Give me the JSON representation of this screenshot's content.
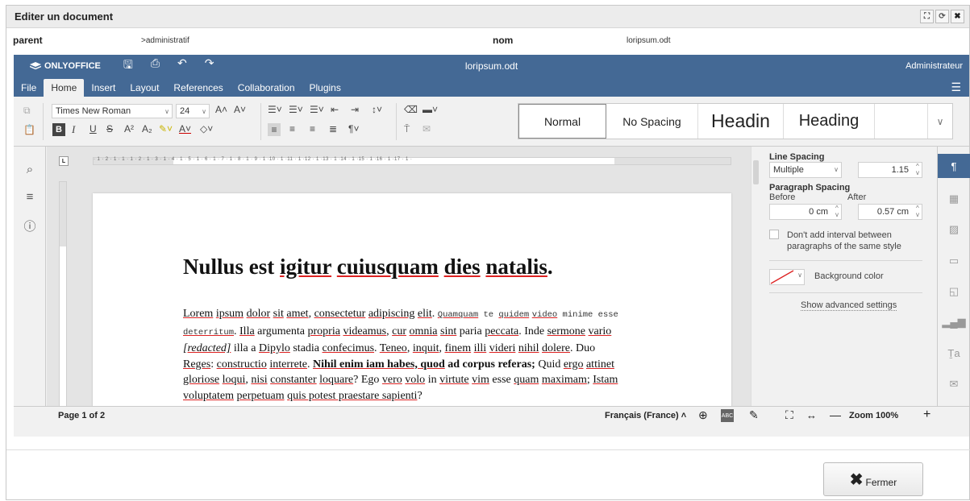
{
  "dialog": {
    "title": "Editer un document"
  },
  "meta": {
    "parent_label": "parent",
    "parent_value": ">administratif",
    "name_label": "nom",
    "name_value": "loripsum.odt"
  },
  "editor": {
    "brand": "ONLYOFFICE",
    "doc_title": "loripsum.odt",
    "user": "Administrateur",
    "tabs": [
      "File",
      "Home",
      "Insert",
      "Layout",
      "References",
      "Collaboration",
      "Plugins"
    ],
    "active_tab": "Home",
    "font": {
      "family": "Times New Roman",
      "size": "24"
    },
    "styles": [
      "Normal",
      "No Spacing",
      "Headin",
      "Heading"
    ],
    "ruler_h": "· 1 · 2 · 1 · 1 · 1 · 2 · 1 · 3 · 1 · 4 · 1 · 5 · 1 · 6 · 1 · 7 · 1 · 8 · 1 · 9 · 1 ·10 · 1 ·11 · 1 ·12 · 1 ·13 · 1 ·14 · 1 ·15 · 1 ·16 · 1 ·17 · 1 ·"
  },
  "document": {
    "heading": {
      "w1": "Nullus est",
      "w2": "igitur",
      "w3": "cuiusquam",
      "w4": "dies",
      "w5": "natalis",
      "end": "."
    },
    "p": {
      "a1": "Lorem",
      "a2": "ipsum",
      "a3": "dolor",
      "a4": "sit",
      "a5": "amet",
      "a6": ", ",
      "a7": "consectetur",
      "a8": "adipiscing",
      "a9": "elit",
      "m1": "Quamquam",
      "m2": " te ",
      "m3": "quidem",
      "m4": "video",
      "m5": " minime esse",
      "m6": "deterritum",
      "b1": ". ",
      "b2": "Illa",
      "b3": " argumenta ",
      "b4": "propria",
      "b5": "videamus",
      "b6": ", ",
      "b7": "cur",
      "b8": "omnia",
      "b9": "sint",
      "b10": " paria ",
      "b11": "peccata",
      "b12": ". Inde ",
      "b13": "sermone",
      "b14": "vario",
      "c1": "[redacted]",
      "c2": " illa a ",
      "c3": "Dipylo",
      "c4": " stadia ",
      "c5": "confecimus",
      "c6": ". ",
      "c7": "Teneo",
      "c8": ", ",
      "c9": "inquit",
      "c10": ", ",
      "c11": "finem",
      "c12": "illi",
      "c13": "videri",
      "c14": "nihil",
      "c15": "dolere",
      "c16": ". Duo",
      "d1": "Reges",
      "d2": ": ",
      "d3": "constructio",
      "d4": "interrete",
      "d5": ". ",
      "d6": "Nihil enim iam habes, quod",
      "d7": " ad corpus referas;",
      "d8": " Quid ",
      "d9": "ergo",
      "d10": "attinet",
      "e1": "gloriose",
      "e2": "loqui",
      "e3": ", ",
      "e4": "nisi",
      "e5": "constanter",
      "e6": "loquare",
      "e7": "? Ego ",
      "e8": "vero",
      "e9": "volo",
      "e10": " in ",
      "e11": "virtute",
      "e12": "vim",
      "e13": " esse ",
      "e14": "quam",
      "e15": "maximam",
      "e16": "; ",
      "e17": "Istam",
      "f1": "voluptatem",
      "f2": "perpetuam",
      "f3": "quis potest praestare sapienti",
      "f4": "?"
    }
  },
  "panel": {
    "line_spacing_label": "Line Spacing",
    "line_spacing_type": "Multiple",
    "line_spacing_value": "1.15",
    "paragraph_spacing_label": "Paragraph Spacing",
    "before_label": "Before",
    "after_label": "After",
    "before_value": "0 cm",
    "after_value": "0.57 cm",
    "dont_add_interval": "Don't add interval between paragraphs of the same style",
    "background_color": "Background color",
    "advanced_settings": "Show advanced settings"
  },
  "status": {
    "page": "Page 1 of 2",
    "language": "Français (France)",
    "zoom": "Zoom 100%"
  },
  "footer": {
    "close_label": "Fermer"
  },
  "colors": {
    "accent": "#446995",
    "spellcheck": "#dd2222"
  }
}
